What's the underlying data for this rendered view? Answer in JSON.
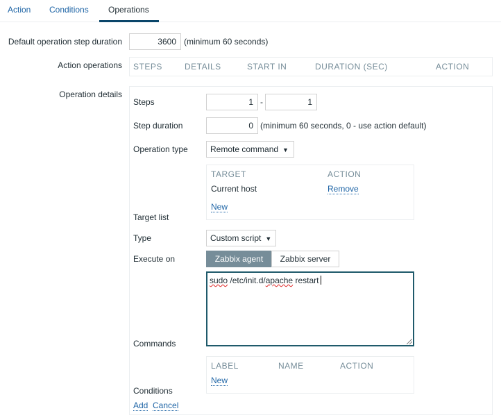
{
  "tabs": [
    {
      "label": "Action",
      "active": false
    },
    {
      "label": "Conditions",
      "active": false
    },
    {
      "label": "Operations",
      "active": true
    }
  ],
  "form": {
    "default_step_duration": {
      "label": "Default operation step duration",
      "value": "3600",
      "hint": "(minimum 60 seconds)"
    },
    "action_operations": {
      "label": "Action operations",
      "columns": [
        "STEPS",
        "DETAILS",
        "START IN",
        "DURATION (SEC)",
        "ACTION"
      ]
    },
    "operation_details": {
      "label": "Operation details",
      "steps": {
        "label": "Steps",
        "from": "1",
        "separator": "-",
        "to": "1"
      },
      "step_duration": {
        "label": "Step duration",
        "value": "0",
        "hint": "(minimum 60 seconds, 0 - use action default)"
      },
      "operation_type": {
        "label": "Operation type",
        "selected": "Remote command"
      },
      "target_list": {
        "label": "Target list",
        "columns": [
          "TARGET",
          "ACTION"
        ],
        "rows": [
          {
            "target": "Current host",
            "action": "Remove"
          }
        ],
        "new_link": "New"
      },
      "type": {
        "label": "Type",
        "selected": "Custom script"
      },
      "execute_on": {
        "label": "Execute on",
        "options": [
          "Zabbix agent",
          "Zabbix server"
        ],
        "selected": "Zabbix agent"
      },
      "commands": {
        "label": "Commands",
        "value_parts": [
          "sudo",
          " /etc/init.d/",
          "apache",
          " restart"
        ]
      },
      "conditions": {
        "label": "Conditions",
        "columns": [
          "LABEL",
          "NAME",
          "ACTION"
        ],
        "new_link": "New"
      },
      "add_link": "Add",
      "cancel_link": "Cancel"
    }
  }
}
